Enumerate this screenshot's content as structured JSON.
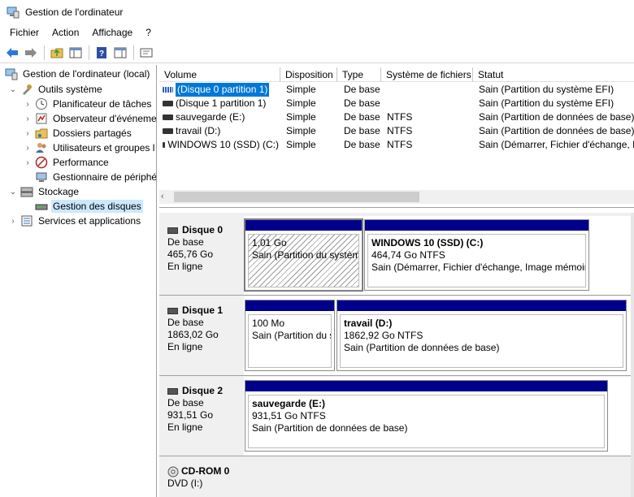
{
  "window": {
    "title": "Gestion de l'ordinateur"
  },
  "menu": [
    "Fichier",
    "Action",
    "Affichage",
    "?"
  ],
  "tree": {
    "root": "Gestion de l'ordinateur (local)",
    "system_tools": "Outils système",
    "task_scheduler": "Planificateur de tâches",
    "event_viewer": "Observateur d'événeme",
    "shared_folders": "Dossiers partagés",
    "users_groups": "Utilisateurs et groupes l",
    "performance": "Performance",
    "device_manager": "Gestionnaire de périphé",
    "storage": "Stockage",
    "disk_management": "Gestion des disques",
    "services": "Services et applications"
  },
  "list": {
    "columns": [
      "Volume",
      "Disposition",
      "Type",
      "Système de fichiers",
      "Statut"
    ],
    "rows": [
      {
        "volume": "(Disque 0 partition 1)",
        "layout": "Simple",
        "type": "De base",
        "fs": "",
        "status": "Sain (Partition du système EFI)"
      },
      {
        "volume": "(Disque 1 partition 1)",
        "layout": "Simple",
        "type": "De base",
        "fs": "",
        "status": "Sain (Partition du système EFI)"
      },
      {
        "volume": "sauvegarde (E:)",
        "layout": "Simple",
        "type": "De base",
        "fs": "NTFS",
        "status": "Sain (Partition de données de base)"
      },
      {
        "volume": "travail (D:)",
        "layout": "Simple",
        "type": "De base",
        "fs": "NTFS",
        "status": "Sain (Partition de données de base)"
      },
      {
        "volume": "WINDOWS 10 (SSD) (C:)",
        "layout": "Simple",
        "type": "De base",
        "fs": "NTFS",
        "status": "Sain (Démarrer, Fichier d'échange, In"
      }
    ]
  },
  "disks": [
    {
      "name": "Disque 0",
      "kind": "De base",
      "size": "465,76 Go",
      "state": "En ligne",
      "partitions": [
        {
          "title": "",
          "size": "1,01 Go",
          "status": "Sain (Partition du systèm"
        },
        {
          "title": "WINDOWS 10 (SSD)  (C:)",
          "size": "464,74 Go NTFS",
          "status": "Sain (Démarrer, Fichier d'échange, Image mémoir"
        }
      ]
    },
    {
      "name": "Disque 1",
      "kind": "De base",
      "size": "1863,02 Go",
      "state": "En ligne",
      "partitions": [
        {
          "title": "",
          "size": "100 Mo",
          "status": "Sain (Partition du s"
        },
        {
          "title": "travail  (D:)",
          "size": "1862,92 Go NTFS",
          "status": "Sain (Partition de données de base)"
        }
      ]
    },
    {
      "name": "Disque 2",
      "kind": "De base",
      "size": "931,51 Go",
      "state": "En ligne",
      "partitions": [
        {
          "title": "sauvegarde  (E:)",
          "size": "931,51 Go NTFS",
          "status": "Sain (Partition de données de base)"
        }
      ]
    },
    {
      "name": "CD-ROM 0",
      "kind": "DVD (I:)"
    }
  ],
  "colors": {
    "partition_header": "#00008b",
    "selection": "#0078d7",
    "tree_selection": "#cce8ff"
  }
}
